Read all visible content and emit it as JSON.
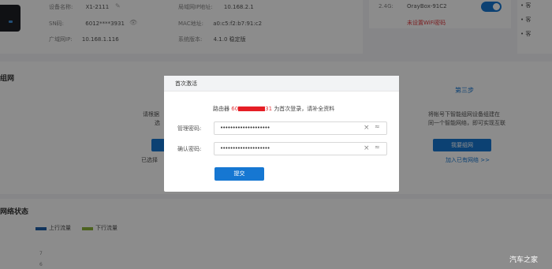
{
  "device": {
    "name_label": "设备名称:",
    "name_value": "X1-2111",
    "sn_label": "SN码:",
    "sn_value": "6012****3931",
    "wan_ip_label": "广域网IP:",
    "wan_ip_value": "10.168.1.116",
    "lan_ip_label": "局域网IP地址:",
    "lan_ip_value": "10.168.2.1",
    "mac_label": "MAC地址:",
    "mac_value": "a0:c5:f2:b7:91:c2",
    "version_label": "系统版本:",
    "version_value": "4.1.0 稳定版"
  },
  "wifi": {
    "band": "2.4G:",
    "ssid": "OrayBox-91C2",
    "warning": "未设置WiFi密码",
    "enabled": true
  },
  "right_panel": {
    "items": [
      "• 客",
      "• 客",
      "• 客"
    ]
  },
  "networking": {
    "title": "组网",
    "step1_line1": "请根据",
    "step1_line2": "选",
    "step1_link": "已选择",
    "step3_title": "第三步",
    "step3_line1": "将帐号下智能组网设备组建在",
    "step3_line2": "同一个智能网络，即可实现互联",
    "step3_button": "我要组网",
    "step3_link": "加入已有网络 >>"
  },
  "status": {
    "title": "网络状态",
    "legend": [
      {
        "label": "上行流量",
        "color": "#1f5fa8"
      },
      {
        "label": "下行流量",
        "color": "#8bb33a"
      }
    ],
    "ticks": [
      "7",
      "6"
    ]
  },
  "modal": {
    "title": "首次激活",
    "msg_prefix": "路由器",
    "msg_sn_start": "60",
    "msg_sn_end": "31",
    "msg_suffix": "为首次登录，请补全资料",
    "admin_pwd_label": "管理密码:",
    "admin_pwd_value": "••••••••••••••••••••",
    "confirm_pwd_label": "确认密码:",
    "confirm_pwd_value": "••••••••••••••••••••",
    "clear_icon": "×",
    "hide_icon": "≈",
    "submit": "提交"
  },
  "watermark": "汽车之家"
}
